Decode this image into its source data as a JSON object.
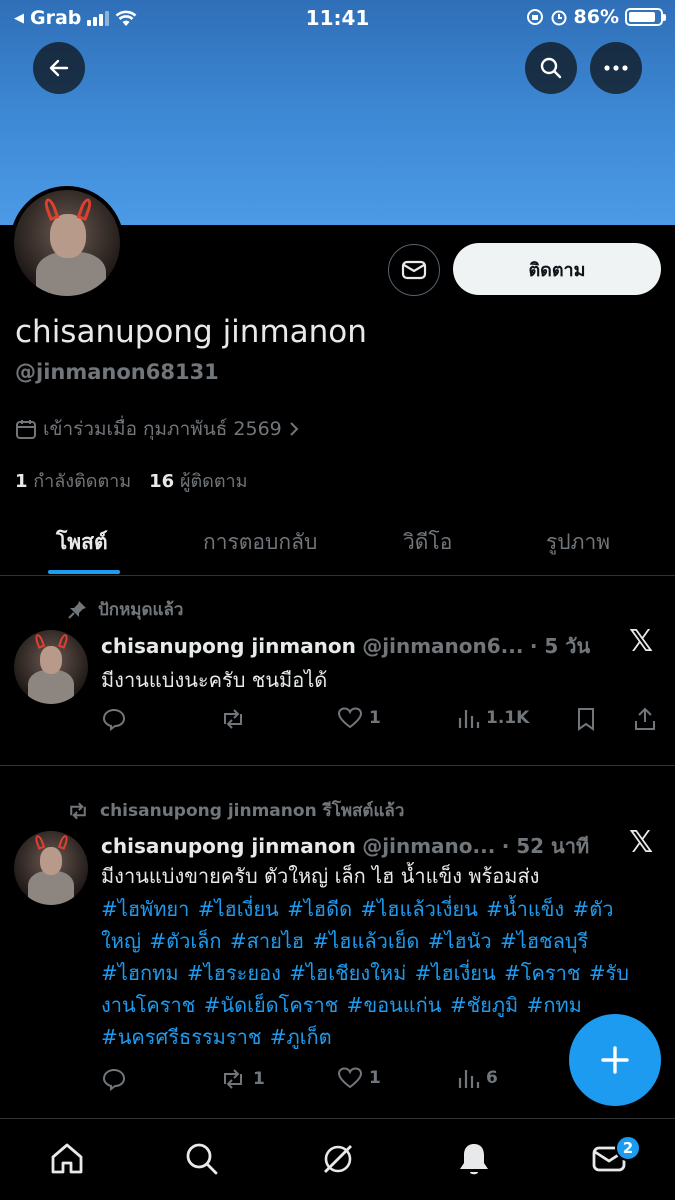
{
  "status_bar": {
    "carrier": "Grab",
    "time": "11:41",
    "battery": "86%"
  },
  "colors": {
    "accent": "#1d9bf0",
    "banner": "#4c9ae6",
    "background": "#000000"
  },
  "profile": {
    "name": "chisanupong jinmanon",
    "handle": "@jinmanon68131",
    "joined": "เข้าร่วมเมื่อ กุมภาพันธ์ 2569",
    "following_count": "1",
    "following_label": "กำลังติดตาม",
    "followers_count": "16",
    "followers_label": "ผู้ติดตาม",
    "follow_button": "ติดตาม"
  },
  "tabs": [
    {
      "label": "โพสต์",
      "active": true
    },
    {
      "label": "การตอบกลับ",
      "active": false
    },
    {
      "label": "วิดีโอ",
      "active": false
    },
    {
      "label": "รูปภาพ",
      "active": false
    }
  ],
  "posts": [
    {
      "context": "ปักหมุดแล้ว",
      "context_icon": "pin-icon",
      "name": "chisanupong jinmanon",
      "handle": "@jinmanon6...",
      "time": "· 5 วัน",
      "text": "มีงานแบ่งนะครับ ชนมือได้",
      "hashtags": "",
      "replies": "",
      "reposts": "",
      "likes": "1",
      "views": "1.1K"
    },
    {
      "context": "chisanupong jinmanon รีโพสต์แล้ว",
      "context_icon": "repost-icon",
      "name": "chisanupong jinmanon",
      "handle": "@jinmano...",
      "time": "· 52 นาที",
      "text": "มีงานแบ่งขายครับ ตัวใหญ่ เล็ก ไฮ น้ำแข็ง พร้อมส่ง",
      "hashtags": "#ไฮพัทยา  #ไฮเงี่ยน #ไฮดีด #ไฮแล้วเงี่ยน #น้ำแข็ง #ตัวใหญ่ #ตัวเล็ก #สายไฮ  #ไฮแล้วเย็ด #ไฮนัว #ไฮชลบุรี #ไฮกทม  #ไฮระยอง #ไฮเชียงใหม่ #ไฮเงี่ยน #โคราช #รับงานโคราช #นัดเย็ดโคราช #ขอนแก่น #ชัยภูมิ #กทม #นครศรีธรรมราช #ภูเก็ต",
      "replies": "",
      "reposts": "1",
      "likes": "1",
      "views": "6"
    }
  ],
  "nav": {
    "messages_badge": "2"
  }
}
